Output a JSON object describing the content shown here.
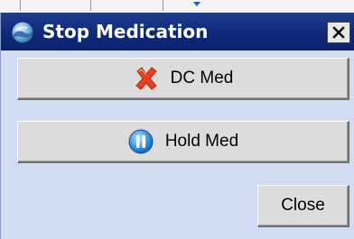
{
  "dialog": {
    "title": "Stop Medication",
    "title_icon": "app-globe-icon",
    "close_icon": "close-x-icon"
  },
  "buttons": {
    "dc_med": {
      "label": "DC Med",
      "icon": "red-x-icon"
    },
    "hold_med": {
      "label": "Hold Med",
      "icon": "pause-circle-icon"
    },
    "close": {
      "label": "Close"
    }
  },
  "colors": {
    "titlebar": "#10287a",
    "dialog_bg": "#d0dcf2",
    "button_face": "#dcdcdc",
    "dc_icon": "#e03a1e",
    "hold_icon": "#2a8fe0"
  }
}
